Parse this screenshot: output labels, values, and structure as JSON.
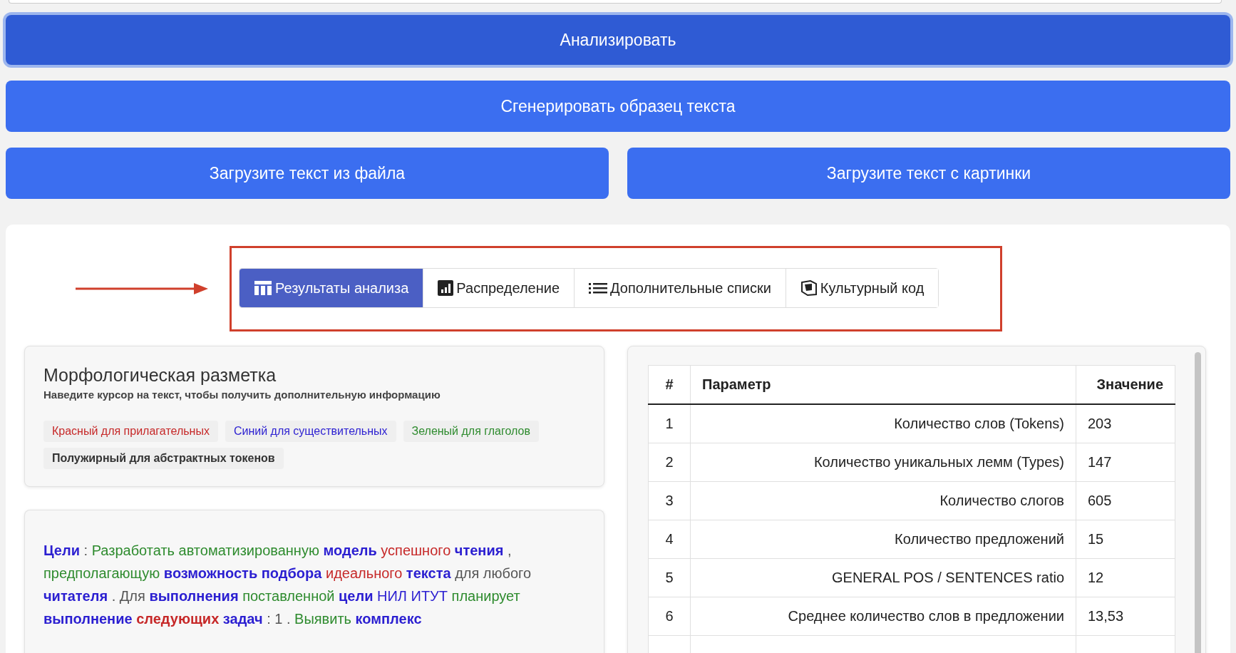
{
  "actions": [
    {
      "label": "Анализировать",
      "focused": true
    },
    {
      "label": "Сгенерировать образец текста",
      "focused": false
    }
  ],
  "uploads": [
    {
      "label": "Загрузите текст из файла"
    },
    {
      "label": "Загрузите текст с картинки"
    }
  ],
  "tabs": [
    {
      "label": "Результаты анализа",
      "selected": true
    },
    {
      "label": "Распределение",
      "selected": false
    },
    {
      "label": "Дополнительные списки",
      "selected": false
    },
    {
      "label": "Культурный код",
      "selected": false
    }
  ],
  "legend": {
    "title": "Морфологическая разметка",
    "hint": "Наведите курсор на текст, чтобы получить дополнительную информацию",
    "items": [
      {
        "label": "Красный для прилагательных",
        "kind": "adj",
        "bold": false
      },
      {
        "label": "Синий для существительных",
        "kind": "noun",
        "bold": false
      },
      {
        "label": "Зеленый для глаголов",
        "kind": "verb",
        "bold": false
      },
      {
        "label": "Полужирный для абстрактных токенов",
        "kind": "other",
        "bold": true
      }
    ]
  },
  "tagged_text": [
    {
      "text": "Цели",
      "kind": "noun",
      "bold": true
    },
    {
      "text": ":",
      "kind": "other",
      "bold": false
    },
    {
      "text": "Разработать",
      "kind": "verb",
      "bold": false
    },
    {
      "text": "автоматизированную",
      "kind": "verb",
      "bold": false
    },
    {
      "text": "модель",
      "kind": "noun",
      "bold": true
    },
    {
      "text": "успешного",
      "kind": "adj",
      "bold": false
    },
    {
      "text": "чтения",
      "kind": "noun",
      "bold": true
    },
    {
      "text": ",",
      "kind": "other",
      "bold": false
    },
    {
      "text": "предполагающую",
      "kind": "verb",
      "bold": false
    },
    {
      "text": "возможность",
      "kind": "noun",
      "bold": true
    },
    {
      "text": "подбора",
      "kind": "noun",
      "bold": true
    },
    {
      "text": "идеального",
      "kind": "adj",
      "bold": false
    },
    {
      "text": "текста",
      "kind": "noun",
      "bold": true
    },
    {
      "text": "для",
      "kind": "other",
      "bold": false
    },
    {
      "text": "любого",
      "kind": "other",
      "bold": false
    },
    {
      "text": "читателя",
      "kind": "noun",
      "bold": true
    },
    {
      "text": ". Для",
      "kind": "other",
      "bold": false
    },
    {
      "text": "выполнения",
      "kind": "noun",
      "bold": true
    },
    {
      "text": "поставленной",
      "kind": "verb",
      "bold": false
    },
    {
      "text": "цели",
      "kind": "noun",
      "bold": true
    },
    {
      "text": "НИЛ ИТУТ",
      "kind": "noun",
      "bold": false
    },
    {
      "text": "планирует",
      "kind": "verb",
      "bold": false
    },
    {
      "text": "выполнение",
      "kind": "noun",
      "bold": true
    },
    {
      "text": "следующих",
      "kind": "adj",
      "bold": true
    },
    {
      "text": "задач",
      "kind": "noun",
      "bold": true
    },
    {
      "text": ": 1 .",
      "kind": "other",
      "bold": false
    },
    {
      "text": "Выявить",
      "kind": "verb",
      "bold": false
    },
    {
      "text": "комплекс",
      "kind": "noun",
      "bold": true
    }
  ],
  "table": {
    "columns": [
      "#",
      "Параметр",
      "Значение"
    ],
    "rows": [
      [
        "1",
        "Количество слов (Tokens)",
        "203"
      ],
      [
        "2",
        "Количество уникальных лемм (Types)",
        "147"
      ],
      [
        "3",
        "Количество слогов",
        "605"
      ],
      [
        "4",
        "Количество предложений",
        "15"
      ],
      [
        "5",
        "GENERAL POS / SENTENCES ratio",
        "12"
      ],
      [
        "6",
        "Среднее количество слов в предложении",
        "13,53"
      ]
    ]
  }
}
